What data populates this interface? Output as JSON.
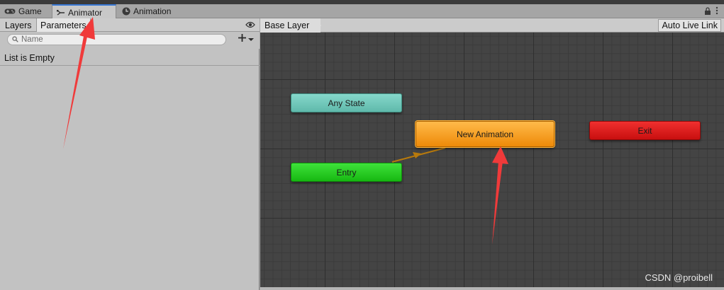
{
  "tabs": [
    {
      "label": "Game",
      "icon": "gamepad-icon"
    },
    {
      "label": "Animator",
      "icon": "animator-icon",
      "active": true
    },
    {
      "label": "Animation",
      "icon": "clock-icon"
    }
  ],
  "left_panel": {
    "tabs": [
      {
        "label": "Layers"
      },
      {
        "label": "Parameters",
        "selected": true
      }
    ],
    "search_placeholder": "Name",
    "empty_text": "List is Empty"
  },
  "graph": {
    "breadcrumb": "Base Layer",
    "auto_live_link": "Auto Live Link",
    "nodes": {
      "any_state": "Any State",
      "entry": "Entry",
      "new_animation": "New Animation",
      "exit": "Exit"
    }
  },
  "watermark": "CSDN @proibell",
  "colors": {
    "any_state": "#6cc6b8",
    "entry": "#22c91c",
    "new_animation": "#f59b1a",
    "exit": "#dc1d1d",
    "annotation_arrow": "#f03a3a",
    "transition": "#b87a0c"
  }
}
